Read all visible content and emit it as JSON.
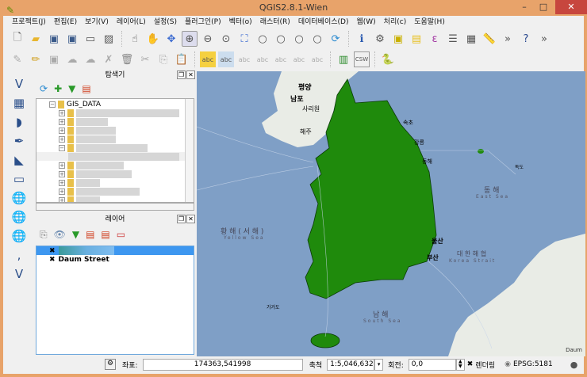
{
  "window": {
    "title": "QGIS2.8.1-Wien"
  },
  "menu": [
    "프로젝트(J)",
    "편집(E)",
    "보기(V)",
    "레이어(L)",
    "설정(S)",
    "플러그인(P)",
    "벡터(o)",
    "래스터(R)",
    "데이터베이스(D)",
    "웹(W)",
    "처리(c)",
    "도움말(H)"
  ],
  "browser": {
    "title": "탐색기",
    "root": "GIS_DATA"
  },
  "layers": {
    "title": "레이어",
    "items": [
      {
        "name": "",
        "checked": true,
        "selected": true
      },
      {
        "name": "Daum Street",
        "checked": true,
        "selected": false
      }
    ]
  },
  "map": {
    "labels": {
      "pyongyang": "평양",
      "nampo": "남포",
      "sariwon": "사리원",
      "haeju": "해주",
      "yellow_sea": "황 해 ( 서 해 )",
      "yellow_sea_en": "Yellow Sea",
      "east_sea": "동 해",
      "east_sea_en": "East Sea",
      "korea_strait": "대 한 해 협",
      "korea_strait_en": "Korea Strait",
      "south_sea": "남 해",
      "south_sea_en": "South Sea",
      "ulsan": "울산",
      "busan": "부산",
      "sokcho": "속초",
      "gangneung": "강릉",
      "donghae": "동해",
      "dokdo": "독도",
      "gageodo": "가거도"
    },
    "colors": {
      "sea": "#7f9fc6",
      "land": "#e9ece6",
      "polygon": "#1f8a0c"
    },
    "attribution": "Daum"
  },
  "status": {
    "coord_label": "좌표:",
    "coord_value": "174363,541998",
    "scale_label": "축척",
    "scale_value": "1:5,046,632",
    "rotation_label": "회전:",
    "rotation_value": "0,0",
    "render_label": "렌더링",
    "render_checked": true,
    "crs": "EPSG:5181"
  }
}
